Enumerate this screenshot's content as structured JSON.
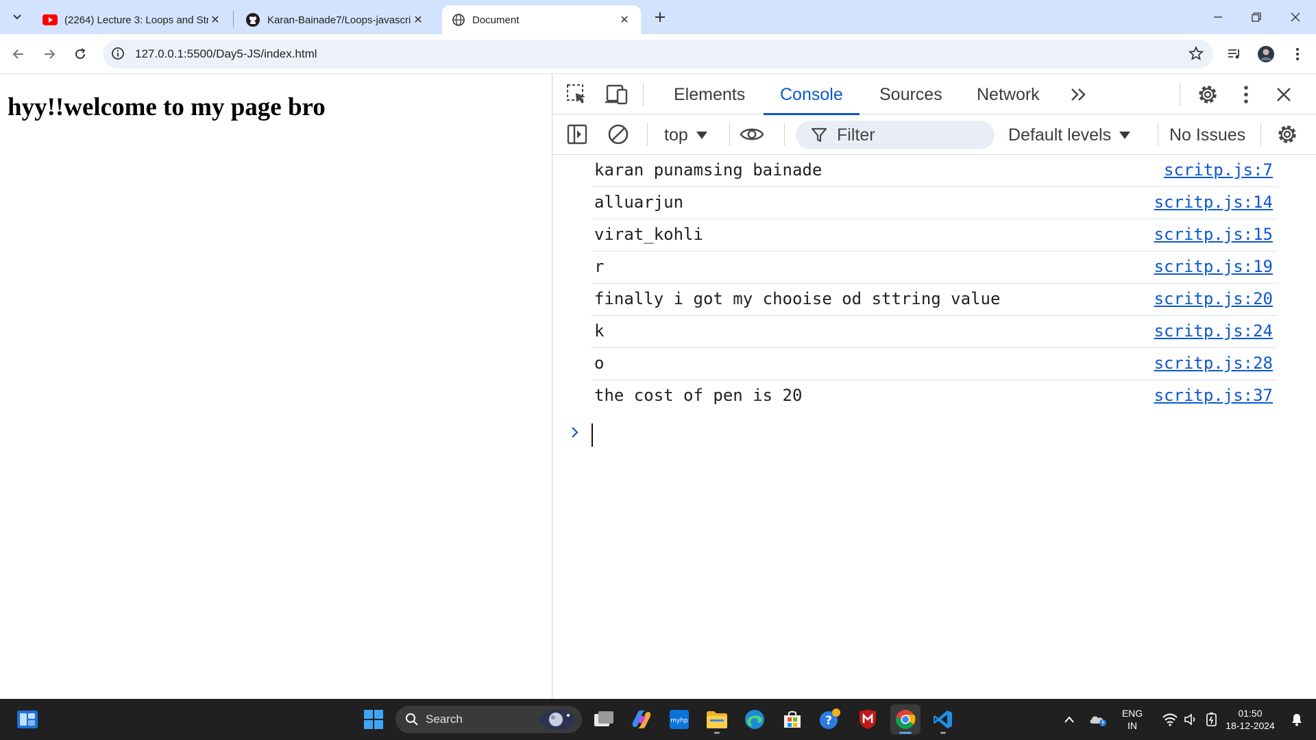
{
  "browser": {
    "tabs": [
      {
        "title": "(2264) Lecture 3: Loops and Stri",
        "icon": "youtube-icon",
        "active": false
      },
      {
        "title": "Karan-Bainade7/Loops-javascrip",
        "icon": "github-icon",
        "active": false
      },
      {
        "title": "Document",
        "icon": "globe-icon",
        "active": true
      }
    ],
    "url": "127.0.0.1:5500/Day5-JS/index.html"
  },
  "page": {
    "heading": "hyy!!welcome to my page bro"
  },
  "devtools": {
    "tabs": [
      "Elements",
      "Console",
      "Sources",
      "Network"
    ],
    "active_tab": "Console",
    "context": "top",
    "filter_placeholder": "Filter",
    "levels": "Default levels",
    "issues": "No Issues",
    "prompt": ">",
    "logs": [
      {
        "message": "karan punamsing bainade",
        "source": "scritp.js:7"
      },
      {
        "message": "alluarjun",
        "source": "scritp.js:14"
      },
      {
        "message": "virat_kohli",
        "source": "scritp.js:15"
      },
      {
        "message": "r",
        "source": "scritp.js:19"
      },
      {
        "message": "finally i got my chooise od sttring value",
        "source": "scritp.js:20"
      },
      {
        "message": "k",
        "source": "scritp.js:24"
      },
      {
        "message": "o",
        "source": "scritp.js:28"
      },
      {
        "message": "the cost of pen is 20",
        "source": "scritp.js:37"
      }
    ]
  },
  "taskbar": {
    "search_placeholder": "Search",
    "lang_line1": "ENG",
    "lang_line2": "IN",
    "time": "01:50",
    "date": "18-12-2024",
    "accent": "#0b57d0"
  }
}
